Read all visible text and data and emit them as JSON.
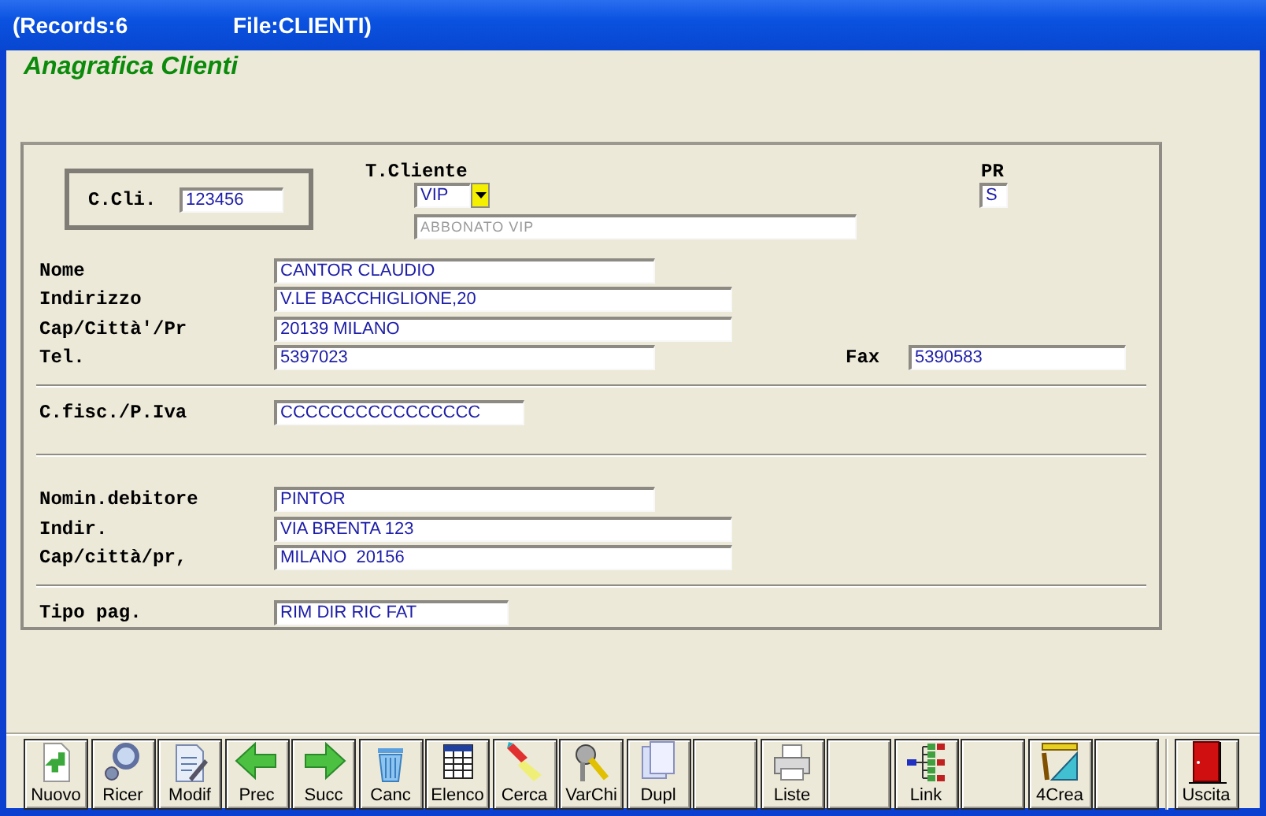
{
  "window": {
    "records": "(Records:6",
    "file": "File:CLIENTI)"
  },
  "heading": "Anagrafica Clienti",
  "code": {
    "label": "C.Cli.",
    "value": "123456"
  },
  "client_type": {
    "label": "T.Cliente",
    "value": "VIP",
    "description": {
      "value": "ABBONATO VIP",
      "disabled": true
    }
  },
  "pr": {
    "label": "PR",
    "value": "S"
  },
  "sections": [
    [
      {
        "label": "Nome",
        "value": "CANTOR CLAUDIO"
      },
      {
        "label": "Indirizzo",
        "value": "V.LE BACCHIGLIONE,20"
      },
      {
        "label": "Cap/Città'/Pr",
        "value": "20139 MILANO"
      },
      {
        "label": "Tel.",
        "value": "5397023",
        "extra": {
          "label": "Fax",
          "value": "5390583"
        }
      }
    ],
    [
      {
        "label": "C.fisc./P.Iva",
        "value": "CCCCCCCCCCCCCCCC"
      }
    ],
    [
      {
        "label": "Nomin.debitore",
        "value": "PINTOR"
      },
      {
        "label": "Indir.",
        "value": "VIA BRENTA 123"
      },
      {
        "label": "Cap/città/pr,",
        "value": "MILANO  20156"
      }
    ],
    [
      {
        "label": "Tipo pag.",
        "value": "RIM DIR RIC FAT"
      }
    ]
  ],
  "toolbar": [
    {
      "kind": "command",
      "label": "Nuovo"
    },
    {
      "kind": "command",
      "label": "Ricer"
    },
    {
      "kind": "command",
      "label": "Modif"
    },
    {
      "kind": "command",
      "label": "Prec"
    },
    {
      "kind": "command",
      "label": "Succ"
    },
    {
      "kind": "command",
      "label": "Canc"
    },
    {
      "kind": "command",
      "label": "Elenco"
    },
    {
      "kind": "command",
      "label": "Cerca"
    },
    {
      "kind": "command",
      "label": "VarChi"
    },
    {
      "kind": "command",
      "label": "Dupl"
    },
    {
      "kind": "blank"
    },
    {
      "kind": "command",
      "label": "Liste"
    },
    {
      "kind": "blank"
    },
    {
      "kind": "command",
      "label": "Link"
    },
    {
      "kind": "blank"
    },
    {
      "kind": "command",
      "label": "4Crea"
    },
    {
      "kind": "blank"
    }
  ],
  "exit": {
    "label": "Uscita"
  }
}
